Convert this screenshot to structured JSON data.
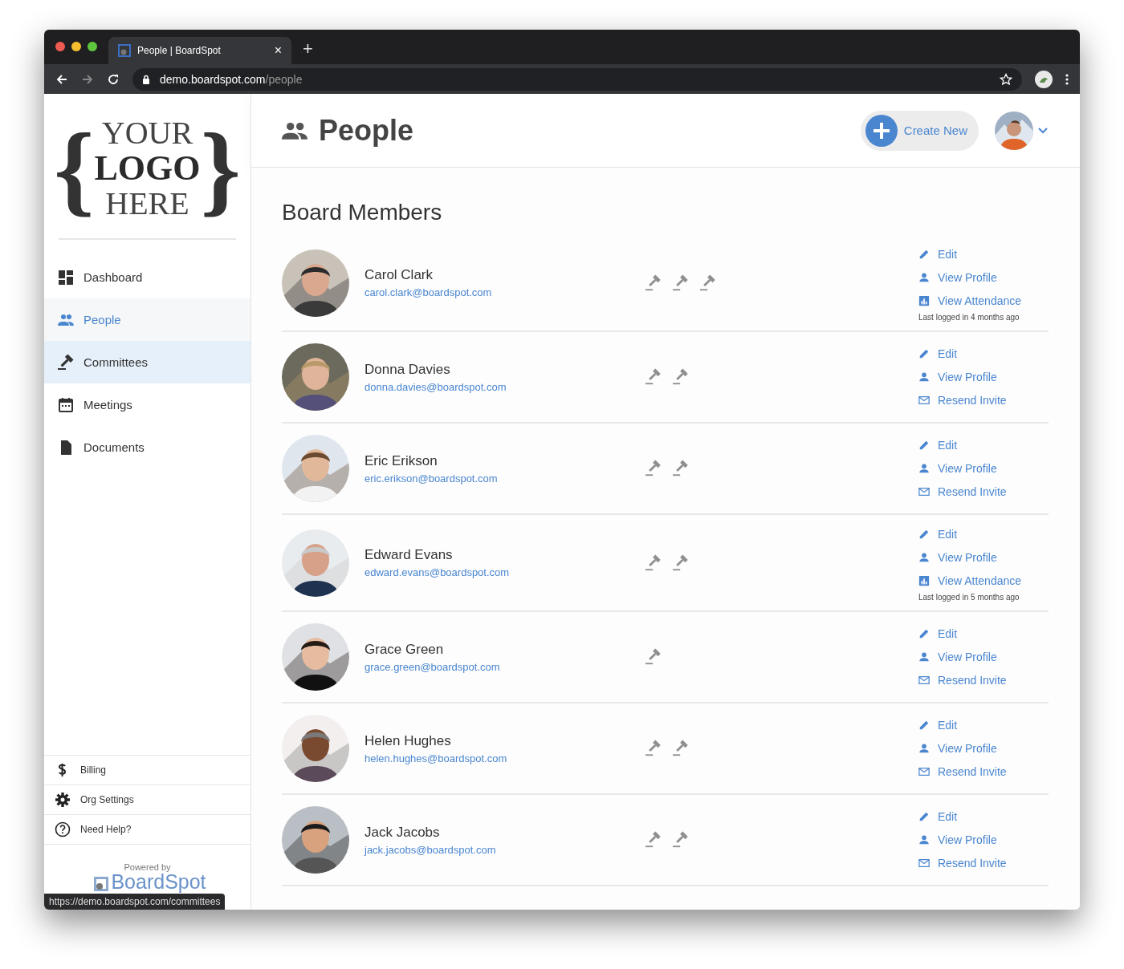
{
  "browser": {
    "tab_title": "People | BoardSpot",
    "tab_close": "×",
    "new_tab": "+",
    "url_host": "demo.boardspot.com",
    "url_path": "/people"
  },
  "logo": {
    "open_brace": "{",
    "lines": [
      "YOUR",
      "LOGO",
      "HERE"
    ],
    "close_brace": "}"
  },
  "sidebar": {
    "items": [
      {
        "kind": "dashboard",
        "label": "Dashboard",
        "selected": false,
        "hovered": false
      },
      {
        "kind": "people",
        "label": "People",
        "selected": true,
        "hovered": false
      },
      {
        "kind": "committees",
        "label": "Committees",
        "selected": false,
        "hovered": true
      },
      {
        "kind": "meetings",
        "label": "Meetings",
        "selected": false,
        "hovered": false
      },
      {
        "kind": "documents",
        "label": "Documents",
        "selected": false,
        "hovered": false
      }
    ],
    "footer_items": [
      {
        "kind": "billing",
        "label": "Billing"
      },
      {
        "kind": "settings",
        "label": "Org Settings"
      },
      {
        "kind": "help",
        "label": "Need Help?"
      }
    ],
    "powered_by": "Powered by",
    "brand": "BoardSpot"
  },
  "status_url": "https://demo.boardspot.com/committees",
  "header": {
    "title": "People",
    "create_button": "Create New"
  },
  "section_title": "Board Members",
  "members": [
    {
      "name": "Carol Clark",
      "email": "carol.clark@boardspot.com",
      "gavels": [
        {
          "kind": "gavel"
        },
        {
          "kind": "gavel"
        },
        {
          "kind": "gavel"
        }
      ],
      "actions": [
        {
          "kind": "edit",
          "label": "Edit"
        },
        {
          "kind": "profile",
          "label": "View Profile"
        },
        {
          "kind": "attendance",
          "label": "View Attendance"
        }
      ],
      "last_login": "Last logged in 4 months ago"
    },
    {
      "name": "Donna Davies",
      "email": "donna.davies@boardspot.com",
      "gavels": [
        {
          "kind": "gavel"
        },
        {
          "kind": "gavel"
        }
      ],
      "actions": [
        {
          "kind": "edit",
          "label": "Edit"
        },
        {
          "kind": "profile",
          "label": "View Profile"
        },
        {
          "kind": "invite",
          "label": "Resend Invite"
        }
      ]
    },
    {
      "name": "Eric Erikson",
      "email": "eric.erikson@boardspot.com",
      "gavels": [
        {
          "kind": "gavel"
        },
        {
          "kind": "gavel"
        }
      ],
      "actions": [
        {
          "kind": "edit",
          "label": "Edit"
        },
        {
          "kind": "profile",
          "label": "View Profile"
        },
        {
          "kind": "invite",
          "label": "Resend Invite"
        }
      ]
    },
    {
      "name": "Edward Evans",
      "email": "edward.evans@boardspot.com",
      "gavels": [
        {
          "kind": "gavel"
        },
        {
          "kind": "gavel"
        }
      ],
      "actions": [
        {
          "kind": "edit",
          "label": "Edit"
        },
        {
          "kind": "profile",
          "label": "View Profile"
        },
        {
          "kind": "attendance",
          "label": "View Attendance"
        }
      ],
      "last_login": "Last logged in 5 months ago"
    },
    {
      "name": "Grace Green",
      "email": "grace.green@boardspot.com",
      "gavels": [
        {
          "kind": "gavel"
        }
      ],
      "actions": [
        {
          "kind": "edit",
          "label": "Edit"
        },
        {
          "kind": "profile",
          "label": "View Profile"
        },
        {
          "kind": "invite",
          "label": "Resend Invite"
        }
      ]
    },
    {
      "name": "Helen Hughes",
      "email": "helen.hughes@boardspot.com",
      "gavels": [
        {
          "kind": "gavel"
        },
        {
          "kind": "gavel"
        }
      ],
      "actions": [
        {
          "kind": "edit",
          "label": "Edit"
        },
        {
          "kind": "profile",
          "label": "View Profile"
        },
        {
          "kind": "invite",
          "label": "Resend Invite"
        }
      ]
    },
    {
      "name": "Jack Jacobs",
      "email": "jack.jacobs@boardspot.com",
      "gavels": [
        {
          "kind": "gavel"
        },
        {
          "kind": "gavel"
        }
      ],
      "actions": [
        {
          "kind": "edit",
          "label": "Edit"
        },
        {
          "kind": "profile",
          "label": "View Profile"
        },
        {
          "kind": "invite",
          "label": "Resend Invite"
        }
      ]
    }
  ]
}
